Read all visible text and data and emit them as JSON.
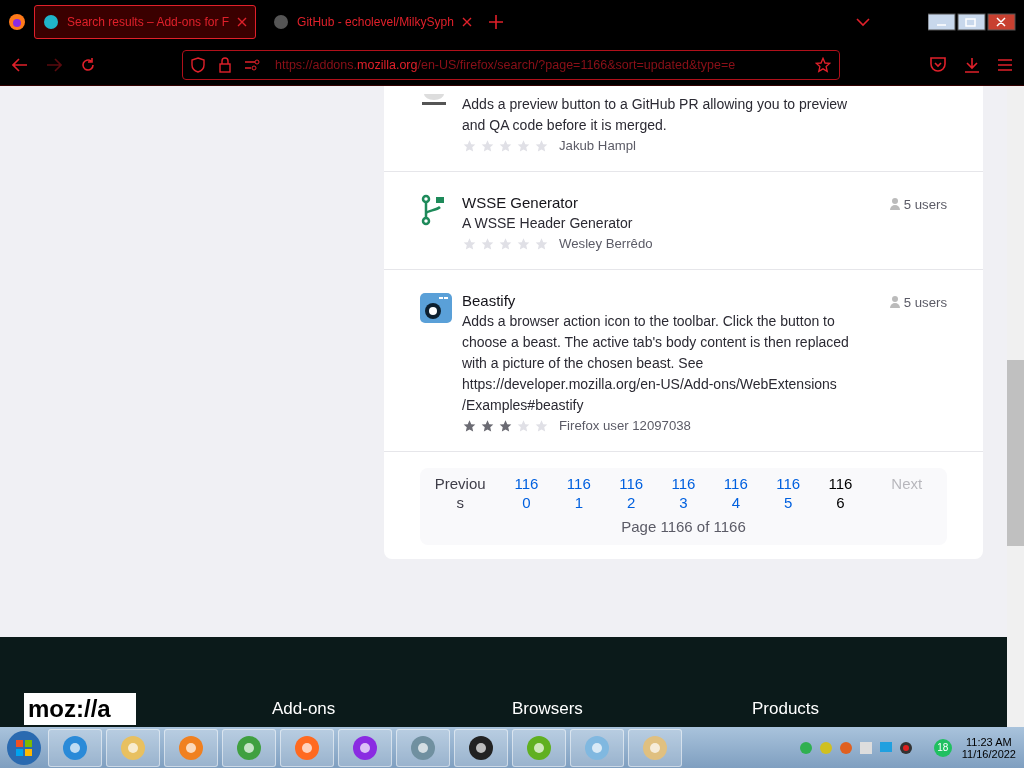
{
  "tabs": [
    {
      "title": "Search results – Add-ons for F",
      "selected": true
    },
    {
      "title": "GitHub - echolevel/MilkySyph",
      "selected": false
    }
  ],
  "address_bar": {
    "before": "https://addons.",
    "domain": "mozilla.org",
    "after": "/en-US/firefox/search/?page=1166&sort=updated&type=e"
  },
  "results": [
    {
      "kind": "previewer",
      "description": "Adds a preview button to a GitHub PR allowing you to preview and QA code before it is merged.",
      "stars": 0,
      "author": "Jakub Hampl"
    },
    {
      "kind": "branch",
      "title": "WSSE Generator",
      "users": "5 users",
      "description": "A WSSE Header Generator",
      "stars": 0,
      "author": "Wesley Berrêdo"
    },
    {
      "kind": "camera",
      "title": "Beastify",
      "users": "5 users",
      "description": "Adds a browser action icon to the toolbar. Click the button to choose a beast. The active tab's body content is then replaced with a picture of the chosen beast. See https://developer.mozilla.org/en-US/Add-ons/WebExtensions /Examples#beastify",
      "stars": 3,
      "author": "Firefox user 12097038"
    }
  ],
  "pagination": {
    "pages": [
      {
        "label": "Previous",
        "kind": "prev",
        "disabled": false,
        "selected": false
      },
      {
        "label": "1160",
        "kind": "page",
        "disabled": false,
        "selected": false
      },
      {
        "label": "1161",
        "kind": "page",
        "disabled": false,
        "selected": false
      },
      {
        "label": "1162",
        "kind": "page",
        "disabled": false,
        "selected": false
      },
      {
        "label": "1163",
        "kind": "page",
        "disabled": false,
        "selected": false
      },
      {
        "label": "1164",
        "kind": "page",
        "disabled": false,
        "selected": false
      },
      {
        "label": "1165",
        "kind": "page",
        "disabled": false,
        "selected": false
      },
      {
        "label": "1166",
        "kind": "page",
        "disabled": false,
        "selected": true
      },
      {
        "label": "Next",
        "kind": "next",
        "disabled": true,
        "selected": false
      }
    ],
    "summary": "Page 1166 of 1166"
  },
  "footer": {
    "logo": "moz://a",
    "headings": [
      "Add-ons",
      "Browsers",
      "Products"
    ]
  },
  "taskbar": {
    "tray_badge": "18",
    "time": "11:23 AM",
    "date": "11/16/2022"
  }
}
